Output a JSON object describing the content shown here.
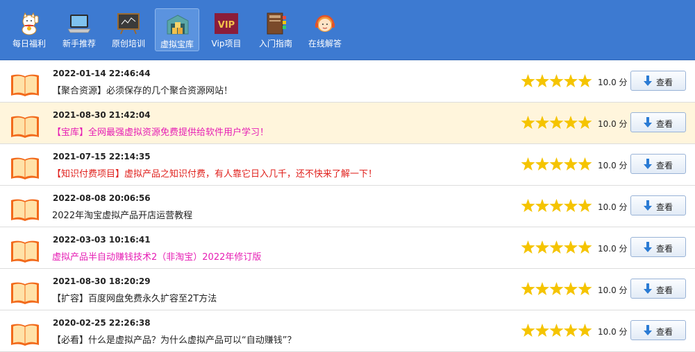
{
  "toolbar": {
    "items": [
      {
        "label": "每日福利",
        "icon": "lucky-cat-icon"
      },
      {
        "label": "新手推荐",
        "icon": "laptop-icon"
      },
      {
        "label": "原创培训",
        "icon": "blackboard-icon"
      },
      {
        "label": "虚拟宝库",
        "icon": "warehouse-icon",
        "active": true
      },
      {
        "label": "Vip项目",
        "icon": "vip-badge-icon"
      },
      {
        "label": "入门指南",
        "icon": "guide-book-icon"
      },
      {
        "label": "在线解答",
        "icon": "support-agent-icon"
      }
    ]
  },
  "view_label": "查看",
  "rating": {
    "stars": 5,
    "max": 5
  },
  "colors": {
    "toolbar": "#3d7ad1",
    "highlight_row": "#fff5dc",
    "star": "#f5c400",
    "book": "#f26a1b"
  },
  "rows": [
    {
      "date": "2022-01-14 22:46:44",
      "title": "【聚合资源】必须保存的几个聚合资源网站！",
      "score": "10.0 分",
      "color": "#222222"
    },
    {
      "date": "2021-08-30 21:42:04",
      "title": "【宝库】全网最强虚拟资源免费提供给软件用户学习！",
      "score": "10.0 分",
      "color": "#e61eb4"
    },
    {
      "date": "2021-07-15 22:14:35",
      "title": "【知识付费项目】虚拟产品之知识付费，有人靠它日入几千，还不快来了解一下！",
      "score": "10.0 分",
      "color": "#e0201c"
    },
    {
      "date": "2022-08-08 20:06:56",
      "title": "2022年淘宝虚拟产品开店运营教程",
      "score": "10.0 分",
      "color": "#222222"
    },
    {
      "date": "2022-03-03 10:16:41",
      "title": "虚拟产品半自动赚钱技术2（非淘宝）2022年修订版",
      "score": "10.0 分",
      "color": "#e61eb4"
    },
    {
      "date": "2021-08-30 18:20:29",
      "title": "【扩容】百度网盘免费永久扩容至2T方法",
      "score": "10.0 分",
      "color": "#222222"
    },
    {
      "date": "2020-02-25 22:26:38",
      "title": "【必看】什么是虚拟产品？为什么虚拟产品可以“自动赚钱”？",
      "score": "10.0 分",
      "color": "#222222"
    }
  ]
}
